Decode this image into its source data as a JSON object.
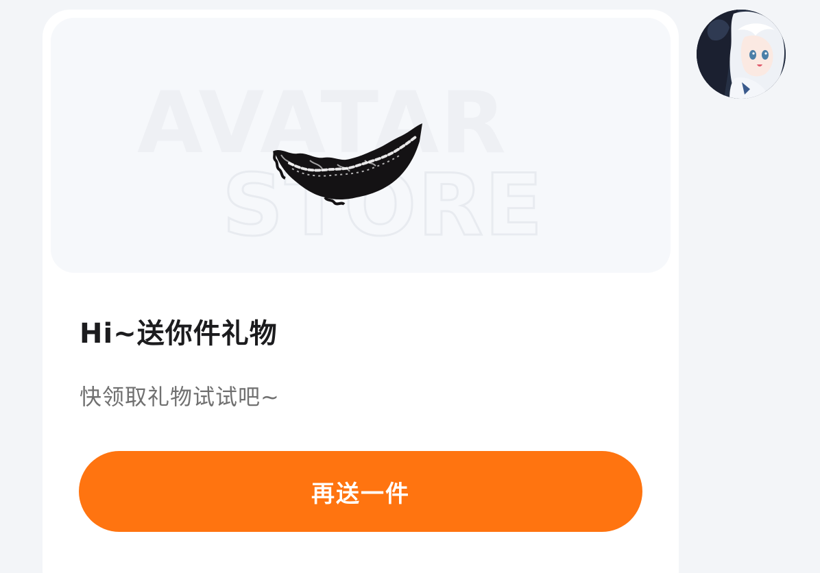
{
  "gift_card": {
    "watermark": {
      "line1": "AVATAR",
      "line2": "STORE"
    },
    "item_image": "lace-mouth-accessory",
    "title": "Hi~送你件礼物",
    "subtitle": "快领取礼物试试吧~",
    "button_label": "再送一件",
    "accent_color": "#ff7410"
  },
  "sender": {
    "avatar": "anime-girl-avatar"
  }
}
